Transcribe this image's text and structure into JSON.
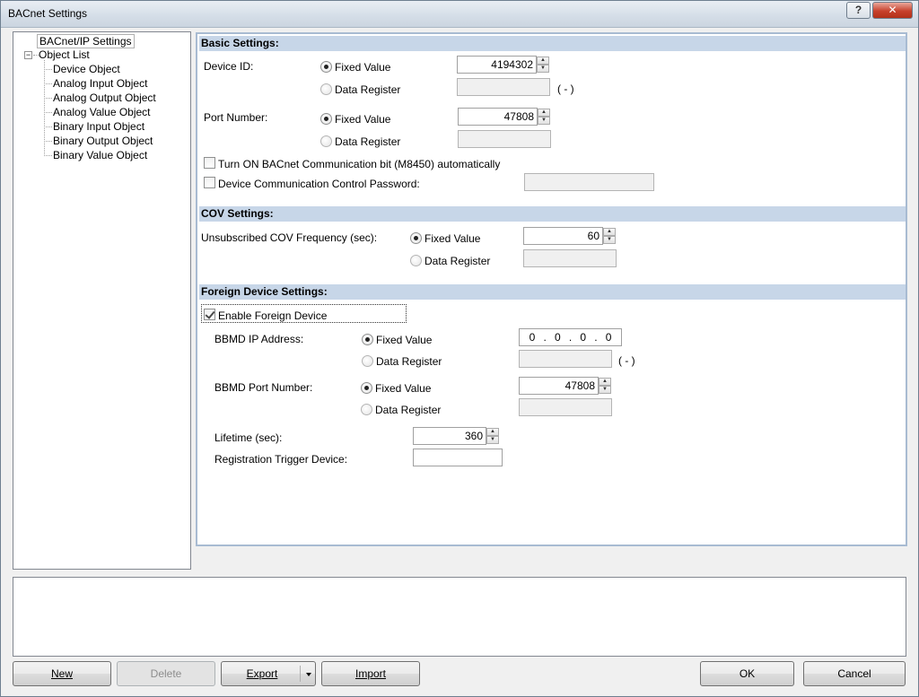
{
  "window": {
    "title": "BACnet Settings",
    "help_label": "?",
    "close_label": "✕"
  },
  "tree": {
    "root_label": "BACnet/IP Settings",
    "object_list_label": "Object List",
    "expander_symbol": "−",
    "children": [
      "Device Object",
      "Analog Input Object",
      "Analog Output Object",
      "Analog Value Object",
      "Binary Input Object",
      "Binary Output Object",
      "Binary Value Object"
    ]
  },
  "basic": {
    "header": "Basic Settings:",
    "device_id_label": "Device ID:",
    "device_id_fixed_label": "Fixed Value",
    "device_id_value": "4194302",
    "device_id_register_label": "Data Register",
    "device_id_suffix": "( - )",
    "port_label": "Port Number:",
    "port_fixed_label": "Fixed Value",
    "port_value": "47808",
    "port_register_label": "Data Register",
    "comm_bit_label": "Turn ON BACnet Communication bit (M8450) automatically",
    "password_label": "Device Communication Control Password:"
  },
  "cov": {
    "header": "COV Settings:",
    "freq_label": "Unsubscribed COV Frequency (sec):",
    "fixed_label": "Fixed Value",
    "value": "60",
    "register_label": "Data Register"
  },
  "foreign": {
    "header": "Foreign Device Settings:",
    "enable_label": "Enable Foreign Device",
    "bbmd_ip_label": "BBMD IP Address:",
    "ip_fixed_label": "Fixed Value",
    "ip_octets": [
      "0",
      ".",
      "0",
      ".",
      "0",
      ".",
      "0"
    ],
    "ip_register_label": "Data Register",
    "ip_suffix": "( - )",
    "bbmd_port_label": "BBMD Port Number:",
    "port_fixed_label": "Fixed Value",
    "port_value": "47808",
    "port_register_label": "Data Register",
    "lifetime_label": "Lifetime (sec):",
    "lifetime_value": "360",
    "trigger_label": "Registration Trigger Device:"
  },
  "buttons": {
    "new": "New",
    "delete": "Delete",
    "export": "Export",
    "import": "Import",
    "ok": "OK",
    "cancel": "Cancel"
  },
  "spin": {
    "up": "▲",
    "down": "▼"
  }
}
